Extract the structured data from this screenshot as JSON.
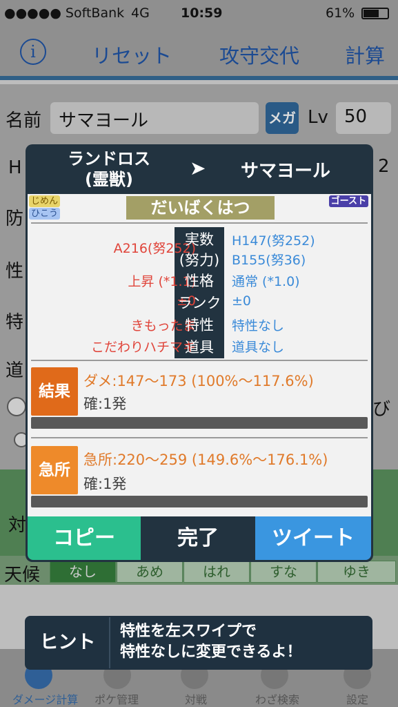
{
  "status_bar": {
    "carrier": "●●●●● SoftBank",
    "network": "4G",
    "time": "10:59",
    "battery": "61%"
  },
  "nav": {
    "info": "i",
    "reset": "リセット",
    "swap": "攻守交代",
    "calc": "計算"
  },
  "form": {
    "name_label": "名前",
    "name_value": "サマヨール",
    "mega": "メガ",
    "lv_label": "Lv",
    "lv_value": "50",
    "h_label": "H",
    "h_value": "2",
    "def_label": "防",
    "nature_label": "性",
    "ability_label": "特",
    "item_label": "道",
    "target_label": "対",
    "weather_label": "天候",
    "fragment": "び"
  },
  "weather": {
    "tabs": [
      "なし",
      "あめ",
      "はれ",
      "すな",
      "ゆき"
    ]
  },
  "modal": {
    "attacker": [
      "ランドロス",
      "(霊獣)"
    ],
    "arrow": "➤",
    "defender": "サマヨール",
    "type1": "じめん",
    "type2": "ひこう",
    "move_type": "ゴースト",
    "move": "だいばくはつ",
    "rows": [
      {
        "left": "A216(努252)",
        "center": "実数",
        "right": "H147(努252)"
      },
      {
        "left": "",
        "center": "(努力)",
        "right": "B155(努36)"
      },
      {
        "left": "上昇 (*1.1)",
        "center": "性格",
        "right": "通常 (*1.0)"
      },
      {
        "left": "±0",
        "center": "ランク",
        "right": "±0"
      },
      {
        "left": "きもったま",
        "center": "特性",
        "right": "特性なし"
      },
      {
        "left": "こだわりハチマキ",
        "center": "道具",
        "right": "道具なし"
      }
    ],
    "result_label": "結果",
    "result_damage": "ダメ:147〜173 (100%〜117.6%)",
    "result_ko": "確:1発",
    "crit_label": "急所",
    "crit_damage": "急所:220〜259 (149.6%〜176.1%)",
    "crit_ko": "確:1発",
    "copy": "コピー",
    "done": "完了",
    "tweet": "ツイート"
  },
  "hint": {
    "label": "ヒント",
    "line1": "特性を左スワイプで",
    "line2": "特性なしに変更できるよ！"
  },
  "tabbar": [
    "ダメージ計算",
    "ポケ管理",
    "対戦",
    "わざ検索",
    "設定"
  ],
  "colors": {
    "modal_bg": "#223340",
    "copy_btn": "#2bbf8e",
    "tweet_btn": "#3a96e0",
    "result": "#e06a1a",
    "crit": "#ee8a2a",
    "attacker_text": "#e0443a",
    "defender_text": "#3a8ad8"
  }
}
